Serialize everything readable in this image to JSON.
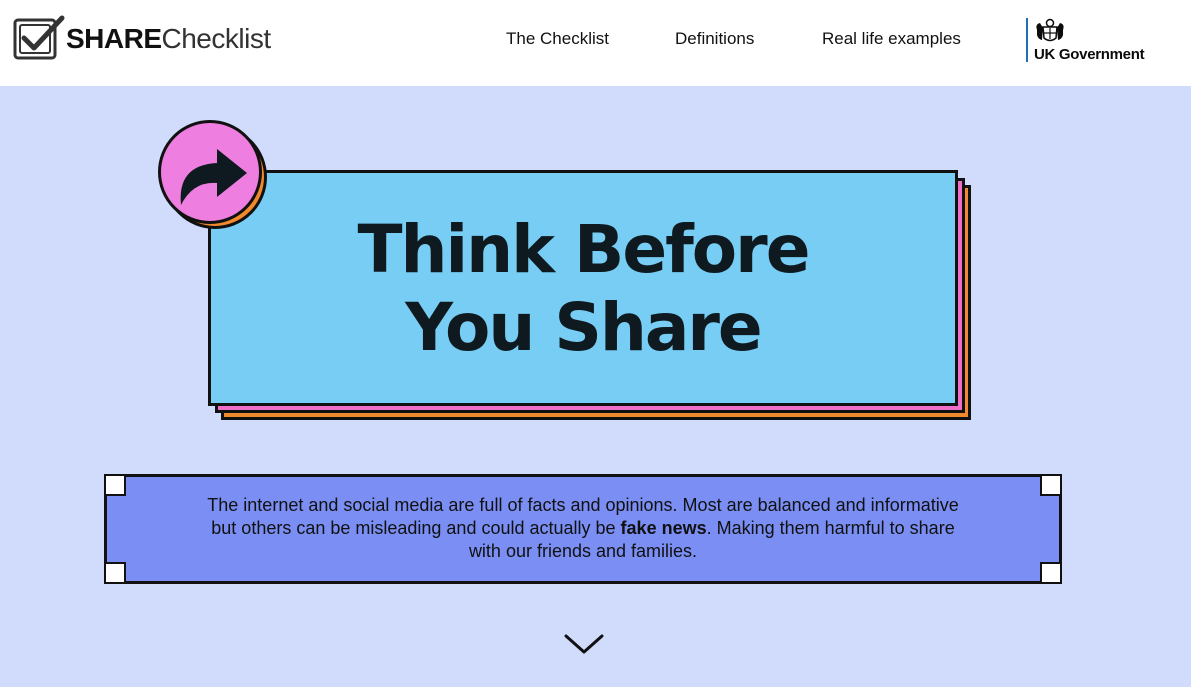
{
  "header": {
    "logo": {
      "strong": "SHARE",
      "light": "Checklist",
      "icon": "checkbox-icon"
    },
    "nav": [
      {
        "label": "The Checklist"
      },
      {
        "label": "Definitions"
      },
      {
        "label": "Real life examples"
      }
    ],
    "government": {
      "label": "UK Government",
      "icon": "royal-crest-icon",
      "accent": "#1d70b8"
    }
  },
  "hero": {
    "title_line1": "Think Before",
    "title_line2": "You Share",
    "icon": "share-arrow-icon",
    "colors": {
      "card": "#78cdf4",
      "layer_pink": "#ee6ec8",
      "layer_orange": "#f08a2c",
      "badge": "#ee7fe0"
    }
  },
  "intro": {
    "text_before": "The internet and social media are full of facts and opinions. Most are balanced and informative but others can be misleading and could actually be ",
    "emphasis": "fake news",
    "text_after": ". Making them harmful to share with our friends and families.",
    "background": "#7a8ef3"
  },
  "scroll": {
    "icon": "chevron-down-icon"
  },
  "page": {
    "background": "#d1dcfd"
  }
}
